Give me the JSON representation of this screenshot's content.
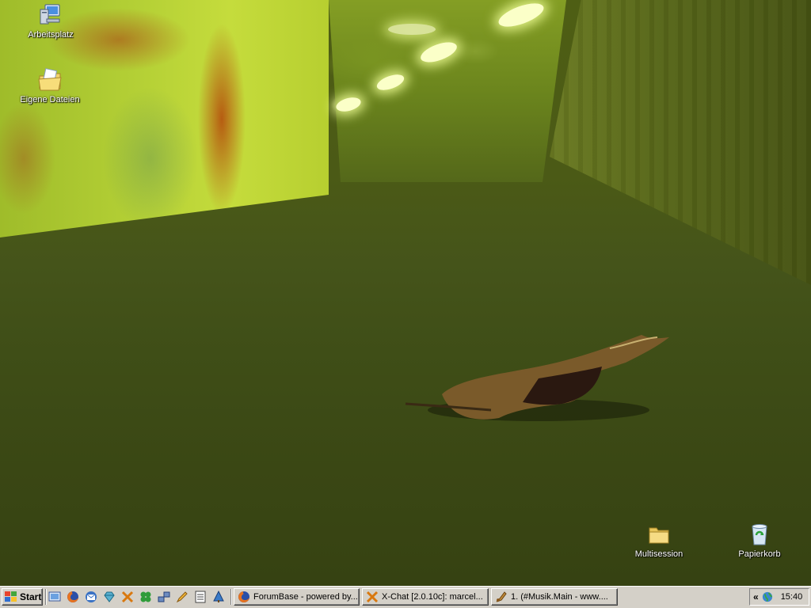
{
  "desktop": {
    "icons": [
      {
        "name": "Arbeitsplatz",
        "icon": "my-computer-icon"
      },
      {
        "name": "Eigene Dateien",
        "icon": "my-documents-icon"
      },
      {
        "name": "Multisession",
        "icon": "folder-icon"
      },
      {
        "name": "Papierkorb",
        "icon": "recycle-bin-icon"
      }
    ]
  },
  "taskbar": {
    "start_label": "Start",
    "quick_launch": [
      "show-desktop-icon",
      "firefox-icon",
      "thunderbird-icon",
      "gem-icon",
      "xchat-icon",
      "clover-icon",
      "network-icon",
      "pen-icon",
      "notepad-icon",
      "tree-icon"
    ],
    "tasks": [
      {
        "label": "ForumBase - powered by...",
        "icon": "firefox-icon"
      },
      {
        "label": "X-Chat [2.0.10c]: marcel...",
        "icon": "xchat-icon"
      },
      {
        "label": "1.   (#Musik.Main - www....",
        "icon": "mirc-icon"
      }
    ],
    "tray": {
      "expand_label": "«",
      "clock": "15:40"
    }
  }
}
